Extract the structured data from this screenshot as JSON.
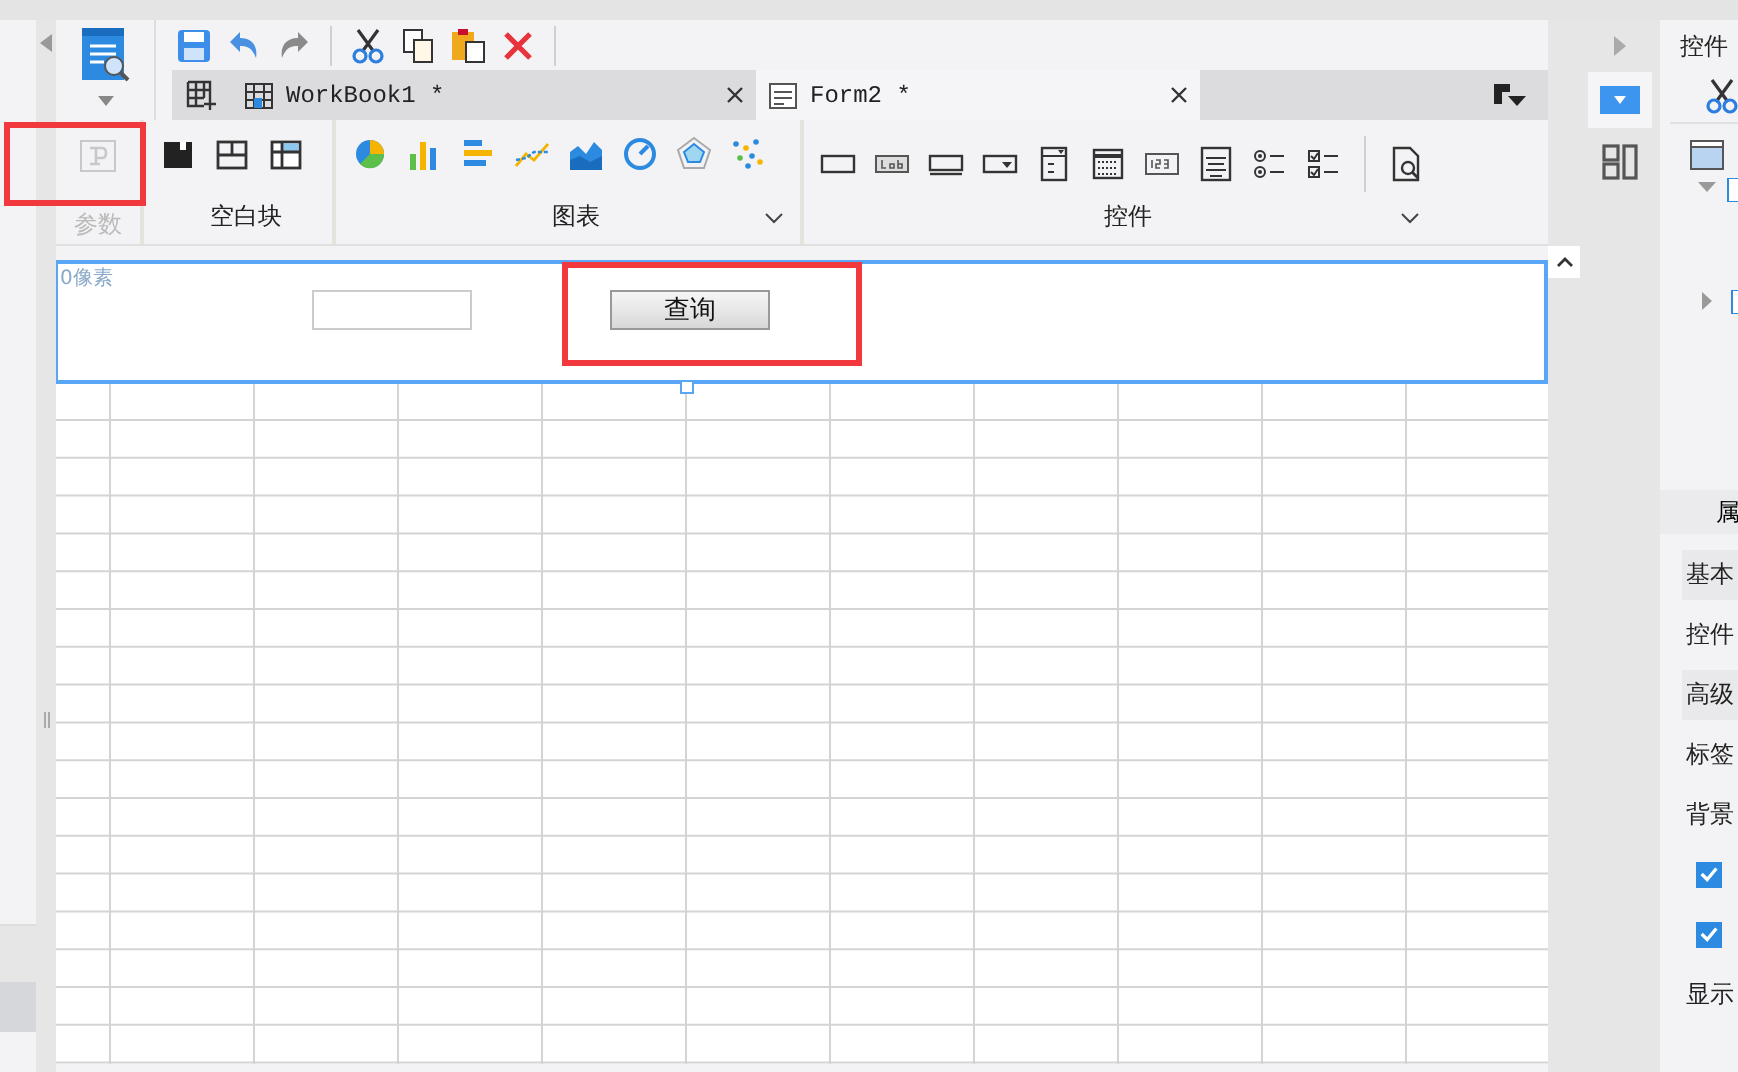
{
  "tabs": [
    {
      "label": "WorkBook1 *",
      "kind": "workbook",
      "selected": false
    },
    {
      "label": "Form2 *",
      "kind": "form",
      "selected": true
    }
  ],
  "parameter_button": {
    "label": "参数",
    "disabled": true
  },
  "ribbon_groups": [
    {
      "label": "空白块",
      "kind": "blocks",
      "menu": false
    },
    {
      "label": "图表",
      "kind": "charts",
      "menu": true
    },
    {
      "label": "控件",
      "kind": "widgets",
      "menu": true
    }
  ],
  "form": {
    "margin_label": "0像素",
    "query_button": "查询"
  },
  "right_panel": {
    "title": "控件",
    "properties_header": "属",
    "rows": [
      {
        "kind": "section",
        "label": "基本"
      },
      {
        "kind": "label",
        "label": "控件"
      },
      {
        "kind": "section",
        "label": "高级"
      },
      {
        "kind": "label",
        "label": "标签"
      },
      {
        "kind": "label",
        "label": "背景"
      },
      {
        "kind": "checkbox",
        "checked": true
      },
      {
        "kind": "checkbox",
        "checked": true
      },
      {
        "kind": "label",
        "label": "显示"
      }
    ]
  }
}
